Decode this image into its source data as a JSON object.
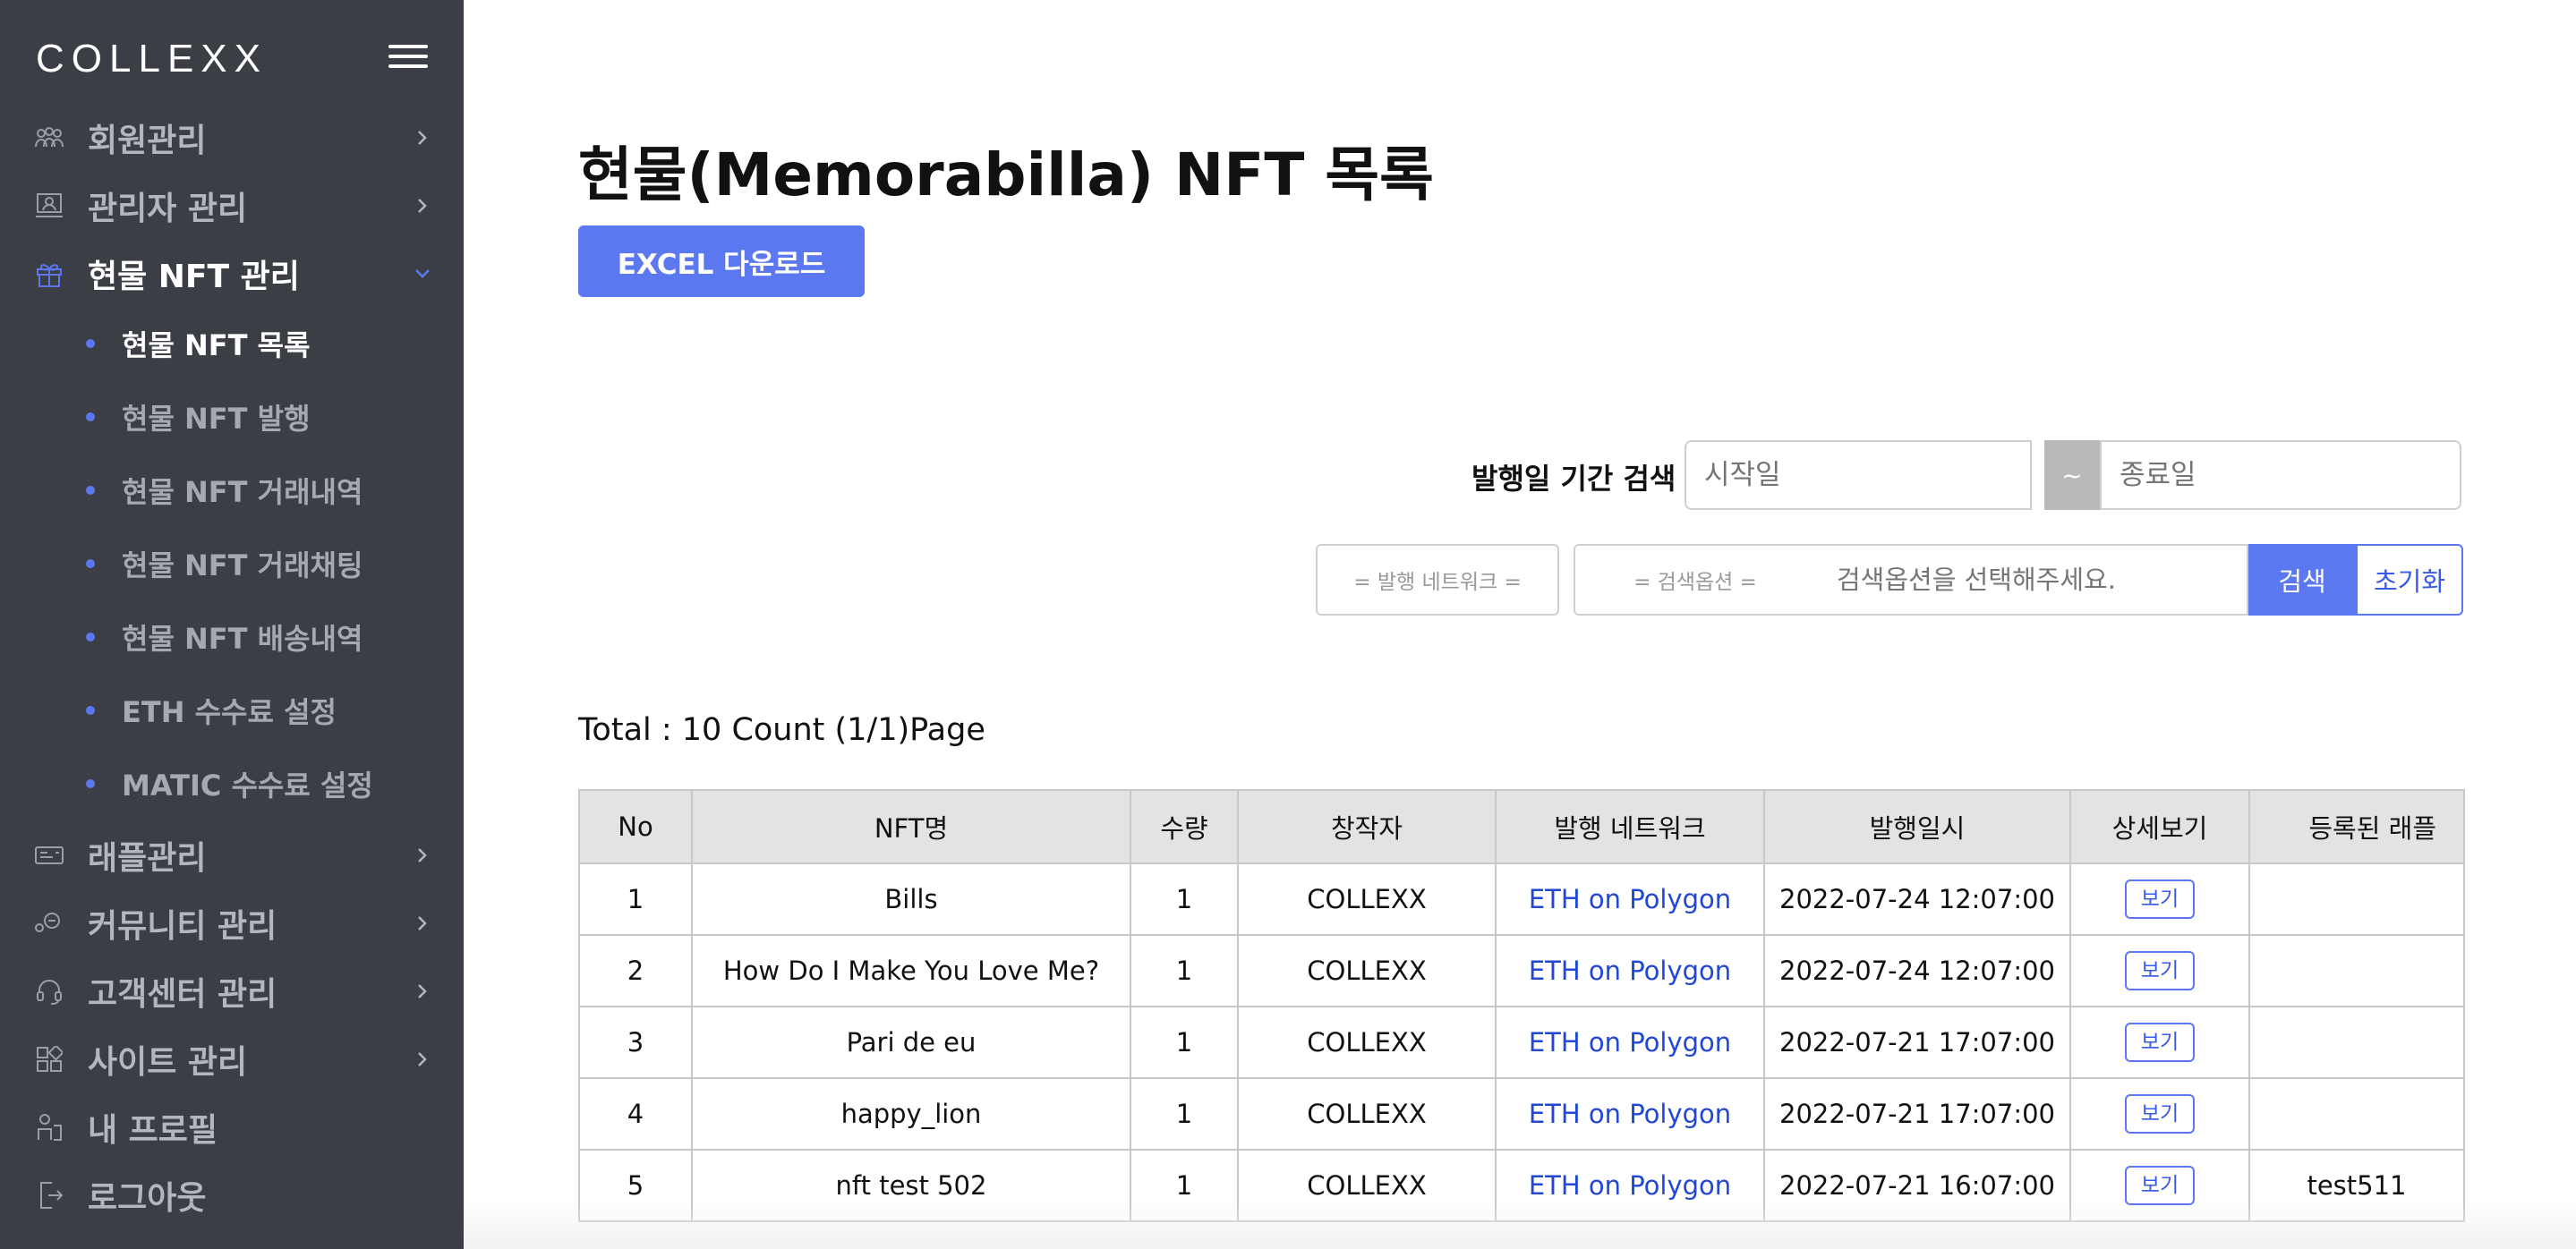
{
  "brand": {
    "logo_text": "COLLEXX"
  },
  "sidebar": {
    "items": [
      {
        "label": "회원관리",
        "icon": "members-icon"
      },
      {
        "label": "관리자 관리",
        "icon": "admin-icon"
      },
      {
        "label": "현물 NFT 관리",
        "icon": "gift-icon",
        "expanded": true
      },
      {
        "label": "래플관리",
        "icon": "ticket-icon"
      },
      {
        "label": "커뮤니티 관리",
        "icon": "community-icon"
      },
      {
        "label": "고객센터 관리",
        "icon": "headset-icon"
      },
      {
        "label": "사이트 관리",
        "icon": "grid-icon"
      },
      {
        "label": "내 프로필",
        "icon": "profile-icon"
      },
      {
        "label": "로그아웃",
        "icon": "logout-icon"
      }
    ],
    "sub_items": [
      {
        "label": "현물 NFT 목록",
        "active": true
      },
      {
        "label": "현물 NFT 발행"
      },
      {
        "label": "현물 NFT 거래내역"
      },
      {
        "label": "현물 NFT 거래채팅"
      },
      {
        "label": "현물 NFT 배송내역"
      },
      {
        "label": "ETH 수수료 설정"
      },
      {
        "label": "MATIC 수수료 설정"
      }
    ]
  },
  "main": {
    "title": "현물(Memorabilla) NFT 목록",
    "excel_button": "EXCEL 다운로드",
    "date_search": {
      "label": "발행일 기간 검색",
      "start_placeholder": "시작일",
      "separator": "~",
      "end_placeholder": "종료일"
    },
    "filters": {
      "network_select": "= 발행 네트워크 =",
      "option_select": "= 검색옵션 =",
      "search_placeholder": "검색옵션을 선택해주세요.",
      "search_button": "검색",
      "reset_button": "초기화"
    },
    "total": "Total : 10 Count (1/1)Page"
  },
  "table": {
    "headers": [
      "No",
      "NFT명",
      "수량",
      "창작자",
      "발행 네트워크",
      "발행일시",
      "상세보기",
      "등록된 래플"
    ],
    "view_label": "보기",
    "rows": [
      {
        "no": "1",
        "name": "Bills",
        "qty": "1",
        "creator": "COLLEXX",
        "network": "ETH on Polygon",
        "date": "2022-07-24 12:07:00",
        "raffle": ""
      },
      {
        "no": "2",
        "name": "How Do I Make You Love Me?",
        "qty": "1",
        "creator": "COLLEXX",
        "network": "ETH on Polygon",
        "date": "2022-07-24 12:07:00",
        "raffle": ""
      },
      {
        "no": "3",
        "name": "Pari de eu",
        "qty": "1",
        "creator": "COLLEXX",
        "network": "ETH on Polygon",
        "date": "2022-07-21 17:07:00",
        "raffle": ""
      },
      {
        "no": "4",
        "name": "happy_lion",
        "qty": "1",
        "creator": "COLLEXX",
        "network": "ETH on Polygon",
        "date": "2022-07-21 17:07:00",
        "raffle": ""
      },
      {
        "no": "5",
        "name": "nft test 502",
        "qty": "1",
        "creator": "COLLEXX",
        "network": "ETH on Polygon",
        "date": "2022-07-21 16:07:00",
        "raffle": "test511"
      }
    ]
  },
  "colors": {
    "sidebar_bg": "#3b3e44",
    "accent": "#5b78f0",
    "link": "#2247d6"
  }
}
